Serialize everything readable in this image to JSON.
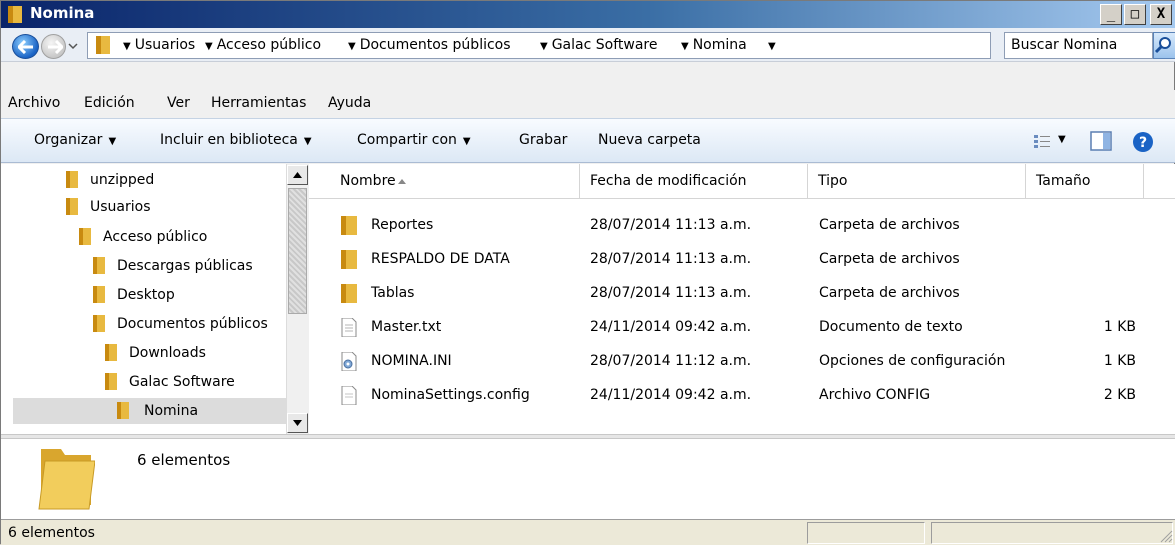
{
  "window": {
    "title": "Nomina"
  },
  "caption_buttons": {
    "minimize": "_",
    "maximize": "□",
    "close": "X"
  },
  "address": {
    "crumbs": [
      "Usuarios",
      "Acceso público",
      "Documentos públicos",
      "Galac Software",
      "Nomina"
    ]
  },
  "search": {
    "value": "Buscar Nomina"
  },
  "menu": [
    "Archivo",
    "Edición",
    "Ver",
    "Herramientas",
    "Ayuda"
  ],
  "toolbar": {
    "organizar": "Organizar",
    "incluir": "Incluir en biblioteca",
    "compartir": "Compartir con",
    "grabar": "Grabar",
    "nueva_carpeta": "Nueva carpeta"
  },
  "tree": [
    {
      "label": "unzipped"
    },
    {
      "label": "Usuarios"
    },
    {
      "label": "Acceso público"
    },
    {
      "label": "Descargas públicas"
    },
    {
      "label": "Desktop"
    },
    {
      "label": "Documentos públicos"
    },
    {
      "label": "Downloads"
    },
    {
      "label": "Galac Software"
    },
    {
      "label": "Nomina"
    }
  ],
  "columns": {
    "name": "Nombre",
    "date": "Fecha de modificación",
    "type": "Tipo",
    "size": "Tamaño"
  },
  "files": [
    {
      "name": "Reportes",
      "date": "28/07/2014 11:13 a.m.",
      "type": "Carpeta de archivos",
      "size": "",
      "icon": "folder-icon"
    },
    {
      "name": "RESPALDO DE DATA",
      "date": "28/07/2014 11:13 a.m.",
      "type": "Carpeta de archivos",
      "size": "",
      "icon": "folder-icon"
    },
    {
      "name": "Tablas",
      "date": "28/07/2014 11:13 a.m.",
      "type": "Carpeta de archivos",
      "size": "",
      "icon": "folder-icon"
    },
    {
      "name": "Master.txt",
      "date": "24/11/2014 09:42 a.m.",
      "type": "Documento de texto",
      "size": "1 KB",
      "icon": "text-file-icon"
    },
    {
      "name": "NOMINA.INI",
      "date": "28/07/2014 11:12 a.m.",
      "type": "Opciones de configuración",
      "size": "1 KB",
      "icon": "settings-file-icon"
    },
    {
      "name": "NominaSettings.config",
      "date": "24/11/2014 09:42 a.m.",
      "type": "Archivo CONFIG",
      "size": "2 KB",
      "icon": "file-icon"
    }
  ],
  "details": {
    "count": "6 elementos"
  },
  "status": {
    "text": "6 elementos"
  },
  "colors": {
    "title_start": "#0a246a",
    "title_end": "#a6caf0",
    "folder": "#e8b940"
  }
}
